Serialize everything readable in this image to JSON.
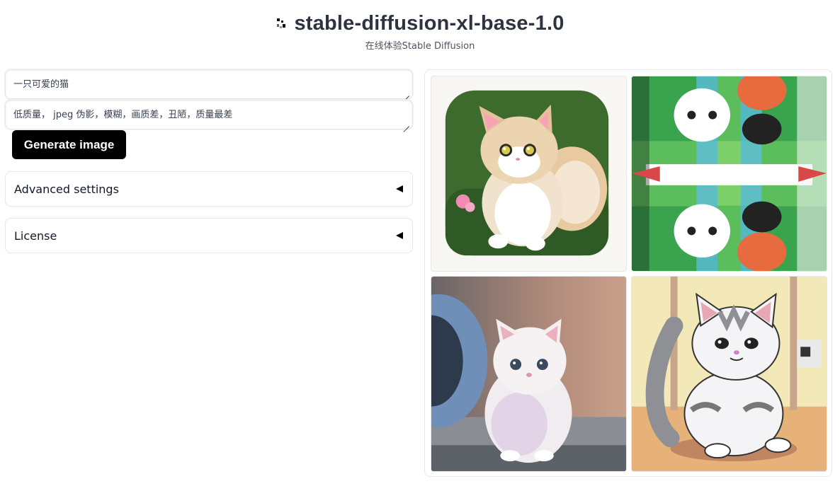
{
  "header": {
    "title": "stable-diffusion-xl-base-1.0",
    "subtitle": "在线体验Stable Diffusion",
    "logo_icon": "pixel-logo-icon"
  },
  "prompt": {
    "value": "一只可爱的猫"
  },
  "negative_prompt": {
    "value": "低质量， jpeg 伪影，模糊，画质差，丑陋，质量最差"
  },
  "generate_button": {
    "label": "Generate image"
  },
  "accordions": [
    {
      "label": "Advanced settings",
      "icon": "triangle-left-icon"
    },
    {
      "label": "License",
      "icon": "triangle-left-icon"
    }
  ],
  "gallery": {
    "images": [
      {
        "subject": "cartoon kitten in rounded frame"
      },
      {
        "subject": "distorted repeating cat pattern"
      },
      {
        "subject": "realistic white kitten"
      },
      {
        "subject": "cartoon grey-white cat sitting"
      }
    ]
  },
  "colors": {
    "button_bg": "#000000",
    "title": "#2d3440",
    "border": "#e5e7eb"
  }
}
